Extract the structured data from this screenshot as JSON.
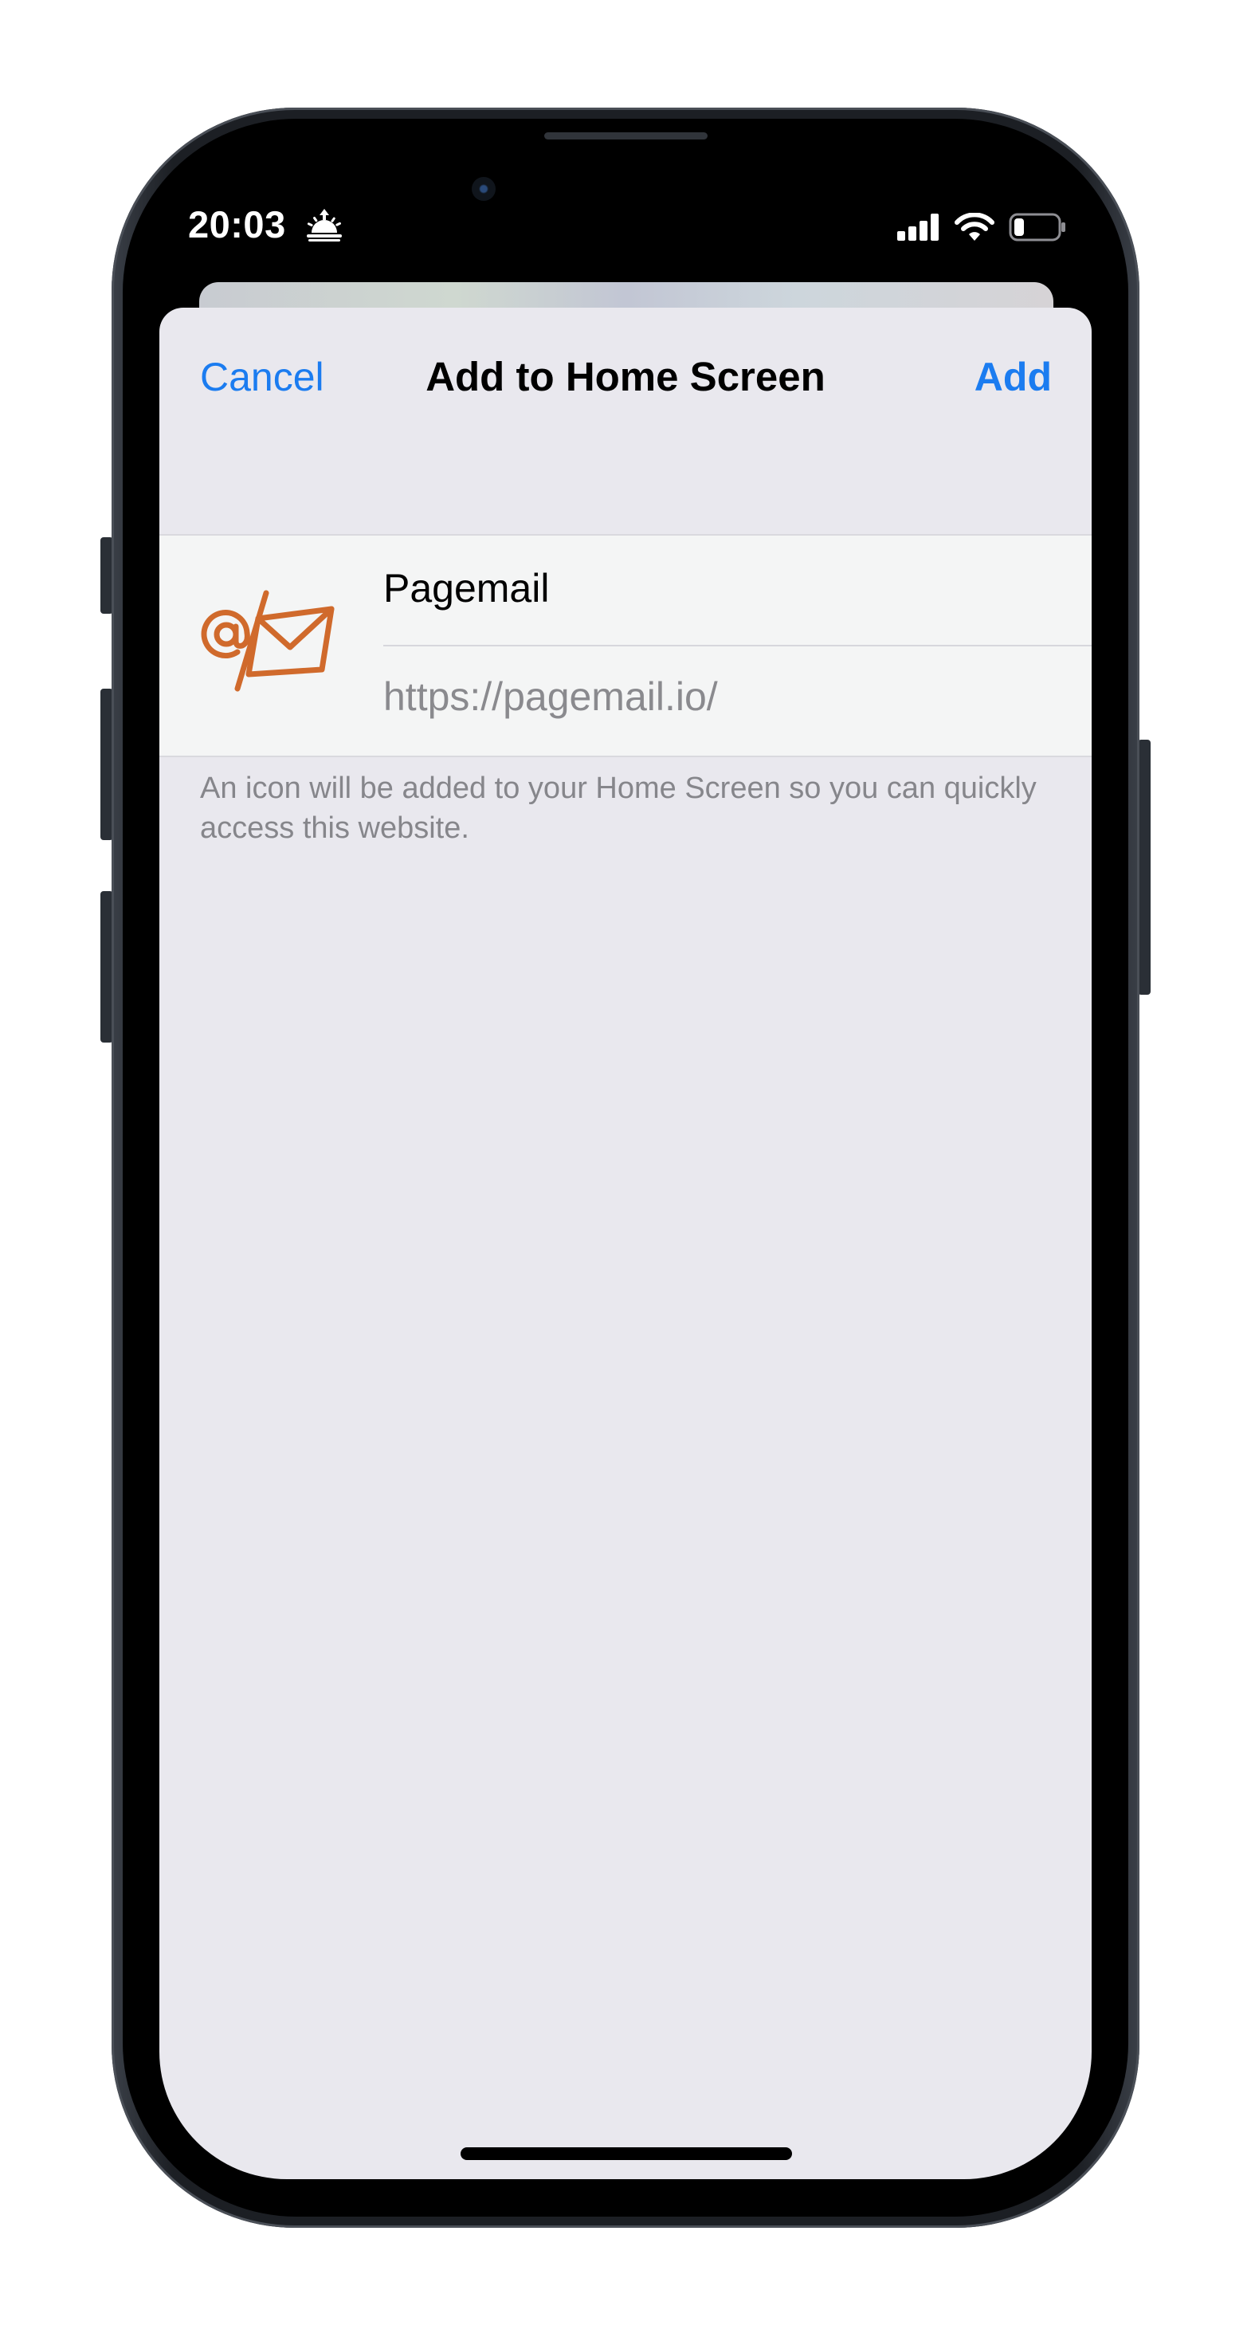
{
  "status_bar": {
    "time": "20:03",
    "sunrise_icon": "sunrise-icon",
    "signal_icon": "cellular-signal-icon",
    "wifi_icon": "wifi-icon",
    "battery_icon": "battery-icon",
    "battery_level": 0.2
  },
  "sheet": {
    "cancel_label": "Cancel",
    "title": "Add to Home Screen",
    "add_label": "Add",
    "accent_color": "#1b7cf0"
  },
  "bookmark": {
    "icon": "pagemail-logo-icon",
    "icon_color": "#d06a2c",
    "name_value": "Pagemail",
    "url_value": "https://pagemail.io/"
  },
  "footnote": "An icon will be added to your Home Screen so you can quickly access this website."
}
